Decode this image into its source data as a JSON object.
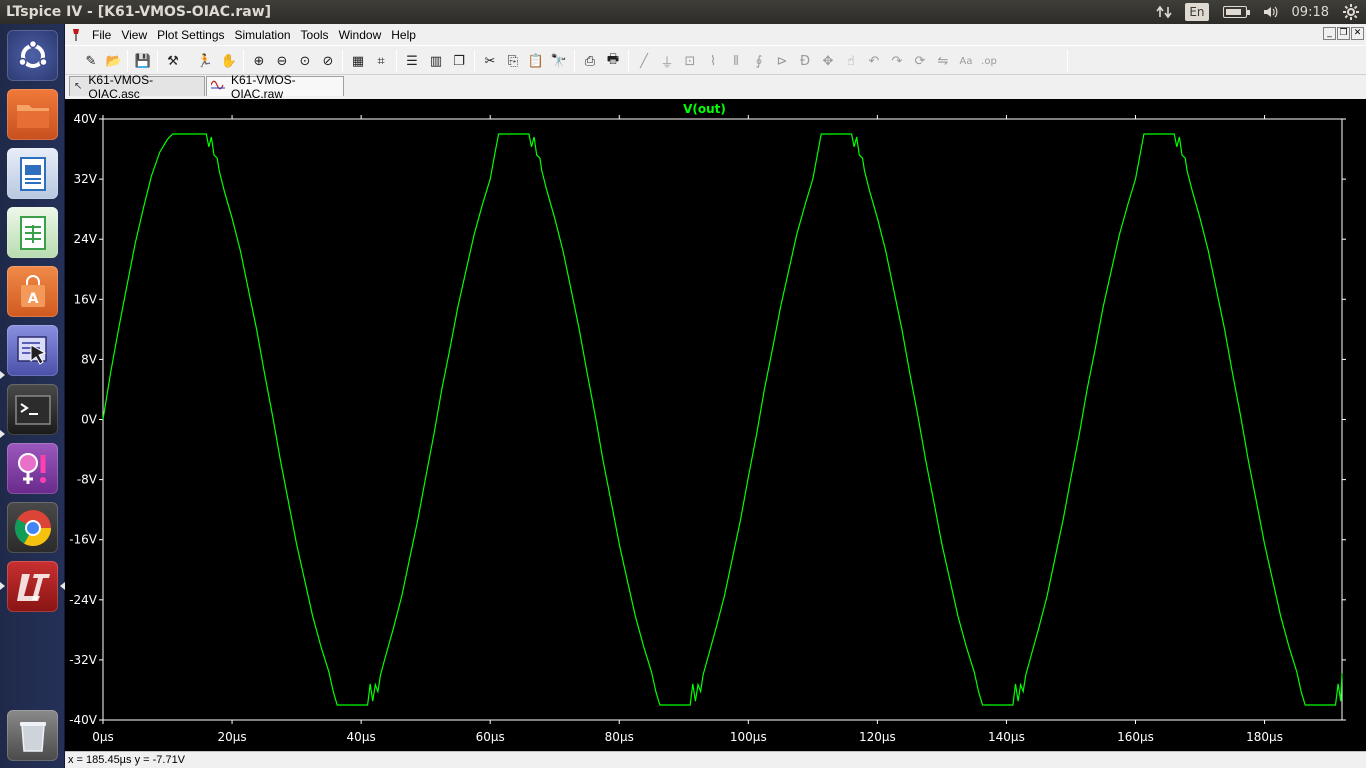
{
  "window": {
    "title": "LTspice IV - [K61-VMOS-OIAC.raw]"
  },
  "indicators": {
    "network_icon": "updown-arrows-icon",
    "keyboard_layout": "En",
    "battery_icon": "battery-icon",
    "battery_level": 0.8,
    "volume_icon": "speaker-icon",
    "clock": "09:18",
    "session_icon": "gear-icon"
  },
  "launcher": {
    "items": [
      {
        "name": "dash-home",
        "icon": "ubuntu-logo-icon",
        "color": "#3a4a8c"
      },
      {
        "name": "files",
        "icon": "folder-icon",
        "color": "#e4632c"
      },
      {
        "name": "writer",
        "icon": "document-icon",
        "color": "#2f6fbf"
      },
      {
        "name": "calc",
        "icon": "spreadsheet-icon",
        "color": "#3aa04a"
      },
      {
        "name": "software-center",
        "icon": "shopping-bag-icon",
        "color": "#e06a2b"
      },
      {
        "name": "ltspice-wine",
        "icon": "cursor-icon",
        "color": "#6b72c8"
      },
      {
        "name": "terminal",
        "icon": "terminal-icon",
        "color": "#2c2c2c"
      },
      {
        "name": "pidgin-app",
        "icon": "gender-icon",
        "color": "#7a3a9c"
      },
      {
        "name": "chrome",
        "icon": "chrome-icon",
        "color": "#3a3a3a"
      },
      {
        "name": "ltspice",
        "icon": "ltspice-logo-icon",
        "color": "#a8201f"
      },
      {
        "name": "trash",
        "icon": "trash-icon",
        "color": "#555"
      }
    ]
  },
  "menubar": {
    "items": [
      "File",
      "View",
      "Plot Settings",
      "Simulation",
      "Tools",
      "Window",
      "Help"
    ]
  },
  "toolbar": {
    "buttons": [
      "new-schematic-icon",
      "open-icon",
      "save-icon",
      "control-panel-icon",
      "run-icon",
      "halt-icon",
      "zoom-in-icon",
      "zoom-out-icon",
      "zoom-fit-icon",
      "zoom-cancel-icon",
      "autorange-icon",
      "cursor-mode-icon",
      "tile-horizontal-icon",
      "tile-vertical-icon",
      "cascade-icon",
      "cut-icon",
      "copy-icon",
      "paste-icon",
      "find-icon",
      "print-preview-icon",
      "print-icon",
      "wire-icon",
      "ground-icon",
      "label-icon",
      "resistor-icon",
      "capacitor-icon",
      "inductor-icon",
      "diode-icon",
      "component-icon",
      "move-icon",
      "drag-icon",
      "undo-icon",
      "redo-icon",
      "rotate-icon",
      "mirror-icon",
      "text-icon",
      "spice-directive-icon"
    ]
  },
  "tabs": [
    {
      "label": "K61-VMOS-OIAC.asc",
      "icon": "schematic-icon",
      "active": false
    },
    {
      "label": "K61-VMOS-OIAC.raw",
      "icon": "waveform-icon",
      "active": true
    }
  ],
  "chart_data": {
    "type": "line",
    "title": "V(out)",
    "xlabel": "",
    "ylabel": "",
    "xlim": [
      0,
      192
    ],
    "ylim": [
      -40,
      40
    ],
    "x_ticks": [
      "0µs",
      "20µs",
      "40µs",
      "60µs",
      "80µs",
      "100µs",
      "120µs",
      "140µs",
      "160µs",
      "180µs"
    ],
    "y_ticks": [
      "40V",
      "32V",
      "24V",
      "16V",
      "8V",
      "0V",
      "-8V",
      "-16V",
      "-24V",
      "-32V",
      "-40V"
    ],
    "grid": false,
    "trace_color": "#00ff00",
    "title_color": "#00ff00",
    "series": [
      {
        "name": "V(out)",
        "x": [
          0,
          1.2,
          2.5,
          3.8,
          5,
          6.3,
          7.5,
          8.8,
          10,
          10.8,
          11.3,
          16,
          16.4,
          16.8,
          17.2,
          17.7,
          18,
          18.8,
          20,
          21.3,
          22.5,
          23.8,
          25,
          26.3,
          27.5,
          28.8,
          30,
          31.3,
          32.5,
          33.8,
          35,
          35.7,
          36.3,
          41,
          41.4,
          41.8,
          42.2,
          42.6,
          43,
          43.8,
          45,
          46.3,
          47.5,
          48.8,
          50,
          51.3,
          52.5,
          53.8,
          55,
          56.3,
          57.5,
          58.8,
          60,
          60.8,
          61.3,
          66,
          66.4,
          66.8,
          67.2,
          67.7,
          68,
          68.8,
          70,
          71.3,
          72.5,
          73.8,
          75,
          76.3,
          77.5,
          78.8,
          80,
          81.3,
          82.5,
          83.8,
          85,
          85.7,
          86.3,
          91,
          91.4,
          91.8,
          92.2,
          92.6,
          93,
          93.8,
          95,
          96.3,
          97.5,
          98.8,
          100,
          101.3,
          102.5,
          103.8,
          105,
          106.3,
          107.5,
          108.8,
          110,
          110.8,
          111.3,
          116,
          116.4,
          116.8,
          117.2,
          117.7,
          118,
          118.8,
          120,
          121.3,
          122.5,
          123.8,
          125,
          126.3,
          127.5,
          128.8,
          130,
          131.3,
          132.5,
          133.8,
          135,
          135.7,
          136.3,
          141,
          141.4,
          141.8,
          142.2,
          142.6,
          143,
          143.8,
          145,
          146.3,
          147.5,
          148.8,
          150,
          151.3,
          152.5,
          153.8,
          155,
          156.3,
          157.5,
          158.8,
          160,
          160.8,
          161.3,
          166,
          166.4,
          166.8,
          167.2,
          167.7,
          168,
          168.8,
          170,
          171.3,
          172.5,
          173.8,
          175,
          176.3,
          177.5,
          178.8,
          180,
          181.3,
          182.5,
          183.8,
          185,
          185.7,
          186.3,
          191,
          191.4,
          191.8,
          192
        ],
        "y": [
          0,
          6.3,
          12.4,
          18.2,
          23.5,
          28.3,
          32.4,
          35.6,
          37.3,
          38,
          38,
          38,
          36.3,
          37.6,
          35.2,
          34.8,
          33.1,
          30.4,
          26.8,
          22.4,
          17.4,
          12,
          6.3,
          0.4,
          -5.5,
          -11.2,
          -16.6,
          -21.6,
          -26.2,
          -30.3,
          -33.6,
          -36.3,
          -38,
          -38,
          -35.2,
          -37.5,
          -35.3,
          -36.2,
          -34,
          -31.5,
          -27.8,
          -23.5,
          -18.6,
          -13.3,
          -7.7,
          -1.9,
          4,
          9.6,
          15,
          20,
          24.6,
          28.6,
          32,
          35.7,
          38,
          38,
          36.3,
          37.6,
          35.2,
          34.8,
          33.1,
          30.4,
          26.8,
          22.4,
          17.4,
          12,
          6.3,
          0.4,
          -5.5,
          -11.2,
          -16.6,
          -21.6,
          -26.2,
          -30.3,
          -33.6,
          -36.3,
          -38,
          -38,
          -35.2,
          -37.5,
          -35.3,
          -36.2,
          -34,
          -31.5,
          -27.8,
          -23.5,
          -18.6,
          -13.3,
          -7.7,
          -1.9,
          4,
          9.6,
          15,
          20,
          24.6,
          28.6,
          32,
          35.7,
          38,
          38,
          36.3,
          37.6,
          35.2,
          34.8,
          33.1,
          30.4,
          26.8,
          22.4,
          17.4,
          12,
          6.3,
          0.4,
          -5.5,
          -11.2,
          -16.6,
          -21.6,
          -26.2,
          -30.3,
          -33.6,
          -36.3,
          -38,
          -38,
          -35.2,
          -37.5,
          -35.3,
          -36.2,
          -34,
          -31.5,
          -27.8,
          -23.5,
          -18.6,
          -13.3,
          -7.7,
          -1.9,
          4,
          9.6,
          15,
          20,
          24.6,
          28.6,
          32,
          35.7,
          38,
          38,
          36.3,
          37.6,
          35.2,
          34.8,
          33.1,
          30.4,
          26.8,
          22.4,
          17.4,
          12,
          6.3,
          0.4,
          -5.5,
          -11.2,
          -16.6,
          -21.6,
          -26.2,
          -30.3,
          -33.6,
          -36.3,
          -38,
          -38,
          -35.2,
          -37.5,
          -33.8
        ]
      }
    ]
  },
  "status": {
    "readout": "x = 185.45µs    y = -7.71V"
  }
}
